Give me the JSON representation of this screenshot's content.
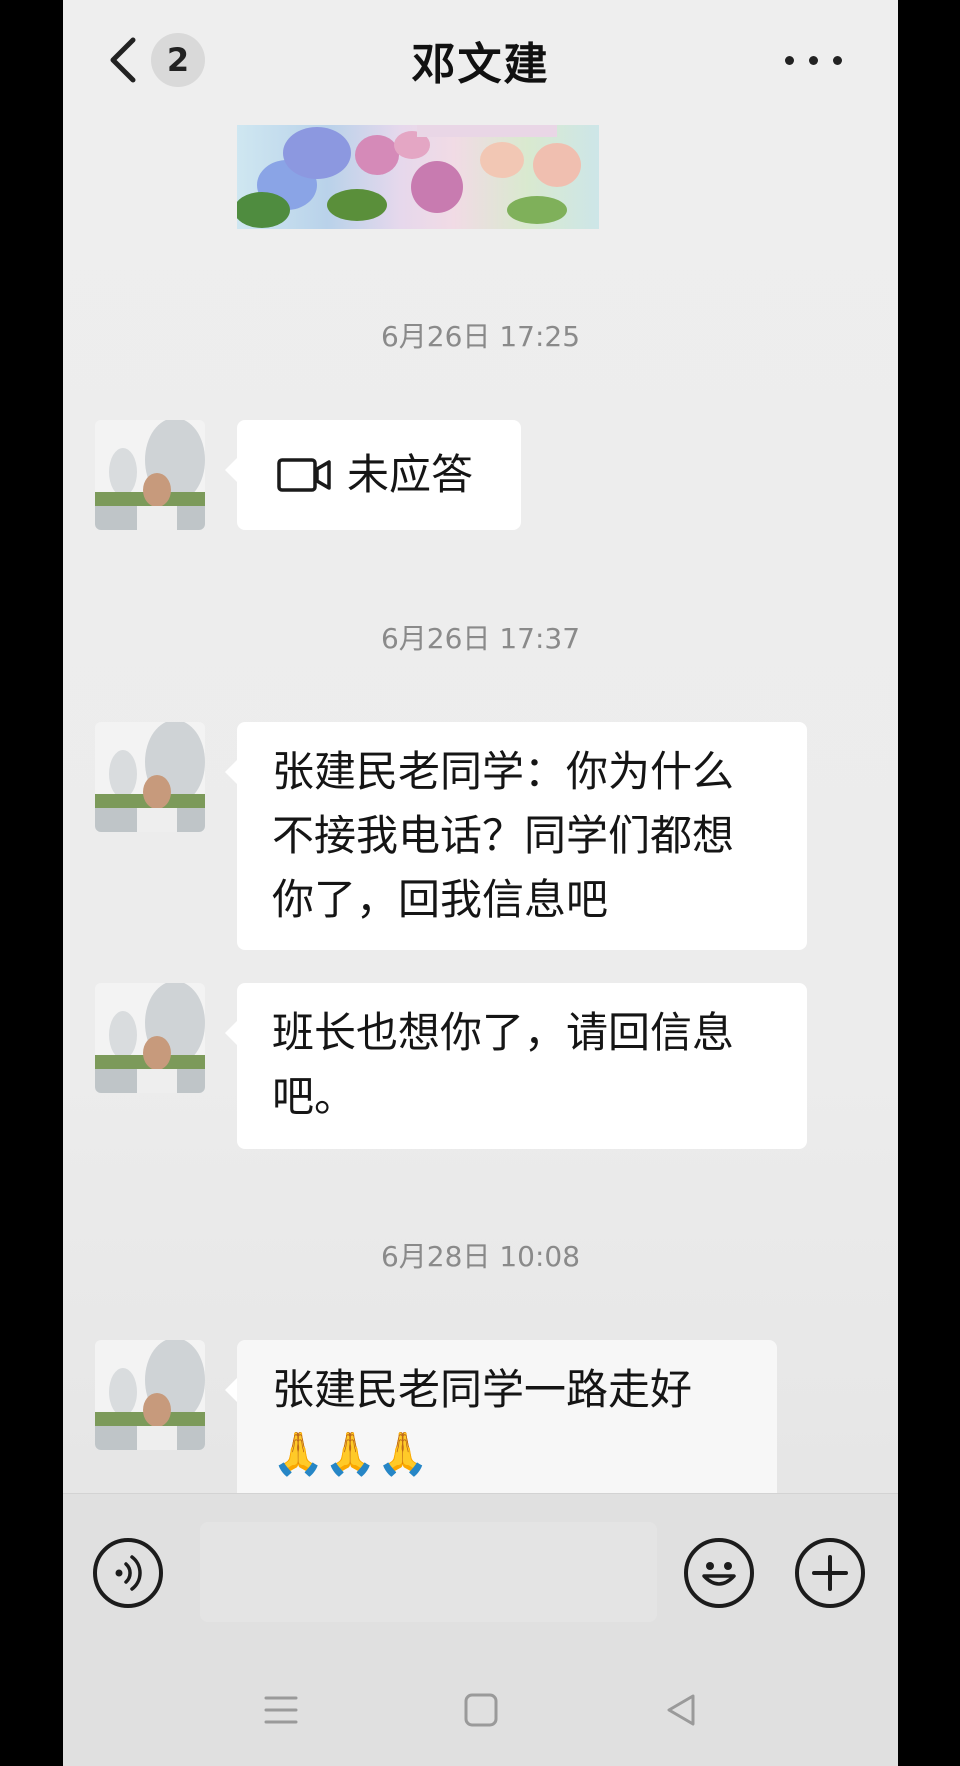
{
  "header": {
    "title": "邓文建",
    "unread_count": "2",
    "back_icon": "chevron-left-icon",
    "more_icon": "more-horizontal-icon"
  },
  "messages": [
    {
      "type": "image",
      "sender": "邓文建",
      "description": "flowers-greeting-image"
    },
    {
      "type": "timestamp",
      "text": "6月26日 17:25"
    },
    {
      "type": "video-call",
      "sender": "邓文建",
      "icon": "video-camera-icon",
      "text": "未应答"
    },
    {
      "type": "timestamp",
      "text": "6月26日 17:37"
    },
    {
      "type": "text",
      "sender": "邓文建",
      "lines": [
        "张建民老同学：你为什么",
        "不接我电话？同学们都想",
        "你了，回我信息吧"
      ]
    },
    {
      "type": "text",
      "sender": "邓文建",
      "lines": [
        "班长也想你了，请回信息",
        "吧。"
      ]
    },
    {
      "type": "timestamp",
      "text": "6月28日 10:08"
    },
    {
      "type": "text",
      "sender": "邓文建",
      "lines": [
        "张建民老同学一路走好",
        "🙏🙏🙏"
      ]
    }
  ],
  "input_bar": {
    "voice_icon": "voice-icon",
    "emoji_icon": "emoji-icon",
    "add_icon": "plus-icon"
  },
  "nav": {
    "menu_icon": "menu-icon",
    "home_icon": "home-square-icon",
    "back_icon": "triangle-back-icon"
  },
  "colors": {
    "bubble": "#ffffff",
    "background": "#ececec",
    "timestamp": "#8a8a8a"
  }
}
